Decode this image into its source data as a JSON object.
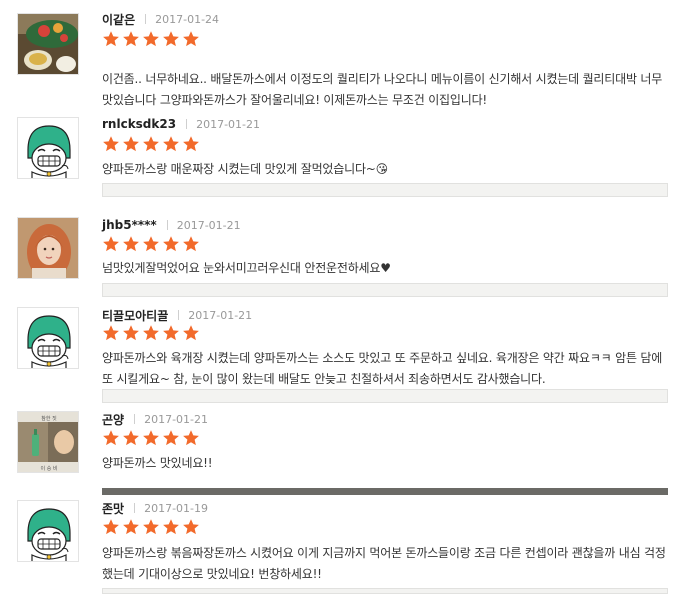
{
  "reviews": [
    {
      "name": "이같은",
      "date": "2017-01-24",
      "rating": 5,
      "avatar": "food-photo-icon",
      "text": "이건좀.. 너무하네요.. 배달돈까스에서 이정도의 퀄리티가 나오다니 메뉴이름이 신기해서 시켰는데 퀄리티대박 너무맛있습니다 그양파와돈까스가 잘어울리네요! 이제돈까스는 무조건 이집입니다!"
    },
    {
      "name": "rnlcksdk23",
      "date": "2017-01-21",
      "rating": 5,
      "avatar": "cartoon-character-icon",
      "text": "양파돈까스랑 매운짜장 시켰는데 맛있게 잘먹었습니다~😘"
    },
    {
      "name": "jhb5****",
      "date": "2017-01-21",
      "rating": 5,
      "avatar": "profile-photo-icon",
      "text": "넘맛있게잘먹었어요 눈와서미끄러우신대 안전운전하세요♥"
    },
    {
      "name": "티끌모아티끌",
      "date": "2017-01-21",
      "rating": 5,
      "avatar": "cartoon-character-icon",
      "text": "양파돈까스와 육개장 시켰는데 양파돈까스는 소스도 맛있고 또 주문하고 싶네요. 육개장은 약간 짜요ㅋㅋ 암튼 담에 또 시킬게요~ 참, 눈이 많이 왔는데 배달도 안늦고 친절하셔서 죄송하면서도 감사했습니다."
    },
    {
      "name": "곤양",
      "date": "2017-01-21",
      "rating": 5,
      "avatar": "drama-still-icon",
      "avatar_caption_top": "참한 짓",
      "avatar_caption_bottom": "이 승 비",
      "text": "양파돈까스 맛있네요!!"
    },
    {
      "name": "존맛",
      "date": "2017-01-19",
      "rating": 5,
      "avatar": "cartoon-character-icon",
      "text": "양파돈까스랑 볶음짜장돈까스 시켰어요 이게 지금까지 먹어본 돈까스들이랑 조금 다른 컨셉이라 괜찮을까 내심 걱정했는데 기대이상으로 맛있네요! 번창하세요!!"
    }
  ],
  "colors": {
    "star": "#f26a2b",
    "name": "#222222",
    "date": "#999999",
    "text": "#333333",
    "cartoon_helmet": "#2fb18a"
  }
}
